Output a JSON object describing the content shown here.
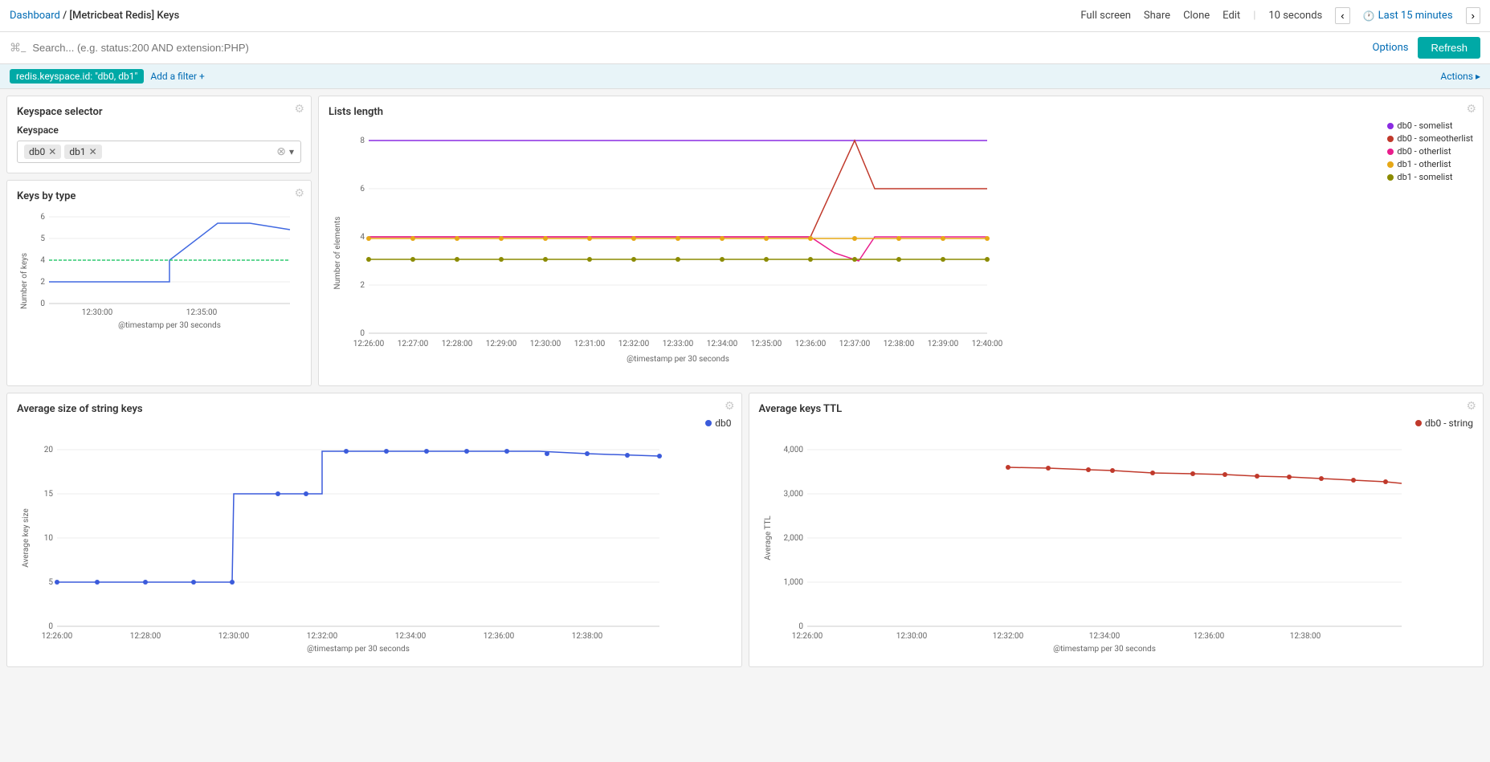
{
  "nav": {
    "breadcrumb_link": "Dashboard",
    "breadcrumb_separator": "/",
    "breadcrumb_current": "[Metricbeat Redis] Keys",
    "actions": [
      "Full screen",
      "Share",
      "Clone",
      "Edit"
    ],
    "auto_refresh_label": "10 seconds",
    "time_range_label": "Last 15 minutes",
    "chevron_left": "‹",
    "chevron_right": "›"
  },
  "search": {
    "icon": "⌘",
    "placeholder": "Search... (e.g. status:200 AND extension:PHP)",
    "options_label": "Options",
    "refresh_label": "Refresh"
  },
  "filter": {
    "tag_label": "redis.keyspace.id: \"db0, db1\"",
    "add_filter_label": "Add a filter +",
    "actions_label": "Actions ▸"
  },
  "keyspace_panel": {
    "title": "Keyspace selector",
    "keyspace_label": "Keyspace",
    "tags": [
      "db0",
      "db1"
    ],
    "gear_icon": "⚙"
  },
  "keys_by_type_panel": {
    "title": "Keys by type",
    "y_label": "Number of keys",
    "x_label": "@timestamp per 30 seconds",
    "x_ticks": [
      "12:30:00",
      "12:35:00"
    ],
    "y_ticks": [
      "0",
      "2",
      "4",
      "6"
    ],
    "gear_icon": "⚙"
  },
  "lists_panel": {
    "title": "Lists length",
    "y_label": "Number of elements",
    "x_label": "@timestamp per 30 seconds",
    "x_ticks": [
      "12:26:00",
      "12:27:00",
      "12:28:00",
      "12:29:00",
      "12:30:00",
      "12:31:00",
      "12:32:00",
      "12:33:00",
      "12:34:00",
      "12:35:00",
      "12:36:00",
      "12:37:00",
      "12:38:00",
      "12:39:00",
      "12:40:00"
    ],
    "y_ticks": [
      "0",
      "2",
      "4",
      "6",
      "8"
    ],
    "legend": [
      {
        "label": "db0 - somelist",
        "color": "#8a2be2"
      },
      {
        "label": "db0 - someotherlist",
        "color": "#c0392b"
      },
      {
        "label": "db0 - otherlist",
        "color": "#e91e8c"
      },
      {
        "label": "db1 - otherlist",
        "color": "#e6a817"
      },
      {
        "label": "db1 - somelist",
        "color": "#8b8b00"
      }
    ],
    "gear_icon": "⚙"
  },
  "avg_size_panel": {
    "title": "Average size of string keys",
    "y_label": "Average key size",
    "x_label": "@timestamp per 30 seconds",
    "x_ticks": [
      "12:26:00",
      "12:28:00",
      "12:30:00",
      "12:32:00",
      "12:34:00",
      "12:36:00",
      "12:38:00"
    ],
    "y_ticks": [
      "0",
      "5",
      "10",
      "15",
      "20"
    ],
    "legend": [
      {
        "label": "db0",
        "color": "#3b5bdb"
      }
    ],
    "gear_icon": "⚙"
  },
  "avg_ttl_panel": {
    "title": "Average keys TTL",
    "y_label": "Average TTL",
    "x_label": "@timestamp per 30 seconds",
    "x_ticks": [
      "12:26:00",
      "12:30:00",
      "12:32:00",
      "12:34:00",
      "12:36:00",
      "12:38:00"
    ],
    "y_ticks": [
      "0",
      "1,000",
      "2,000",
      "3,000",
      "4,000"
    ],
    "legend": [
      {
        "label": "db0 - string",
        "color": "#c0392b"
      }
    ],
    "gear_icon": "⚙"
  }
}
